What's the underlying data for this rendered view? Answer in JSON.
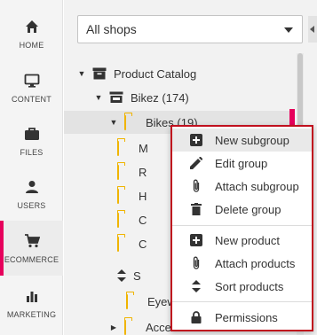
{
  "nav": {
    "items": [
      {
        "label": "HOME",
        "icon": "home-icon"
      },
      {
        "label": "CONTENT",
        "icon": "monitor-icon"
      },
      {
        "label": "FILES",
        "icon": "briefcase-icon"
      },
      {
        "label": "USERS",
        "icon": "user-icon"
      },
      {
        "label": "ECOMMERCE",
        "icon": "cart-icon"
      },
      {
        "label": "MARKETING",
        "icon": "bar-chart-icon"
      }
    ],
    "active_color": "#e6005c"
  },
  "shop_select": {
    "value": "All shops"
  },
  "tree": {
    "rows": [
      {
        "label": "Product Catalog"
      },
      {
        "label": "Bikez (174)"
      },
      {
        "label": "Bikes (19)"
      },
      {
        "label": "M"
      },
      {
        "label": "R"
      },
      {
        "label": "H"
      },
      {
        "label": "C"
      },
      {
        "label": "C"
      },
      {
        "label": "S"
      },
      {
        "label": "Eyew"
      },
      {
        "label": "Acce"
      }
    ]
  },
  "context_menu": {
    "items": [
      {
        "label": "New subgroup",
        "icon": "plus-square-icon"
      },
      {
        "label": "Edit group",
        "icon": "pencil-icon"
      },
      {
        "label": "Attach subgroup",
        "icon": "paperclip-icon"
      },
      {
        "label": "Delete group",
        "icon": "trash-icon"
      },
      {
        "label": "New product",
        "icon": "plus-square-icon"
      },
      {
        "label": "Attach products",
        "icon": "paperclip-icon"
      },
      {
        "label": "Sort products",
        "icon": "sort-icon"
      },
      {
        "label": "Permissions",
        "icon": "lock-icon"
      }
    ],
    "border_color": "#c0101e"
  }
}
